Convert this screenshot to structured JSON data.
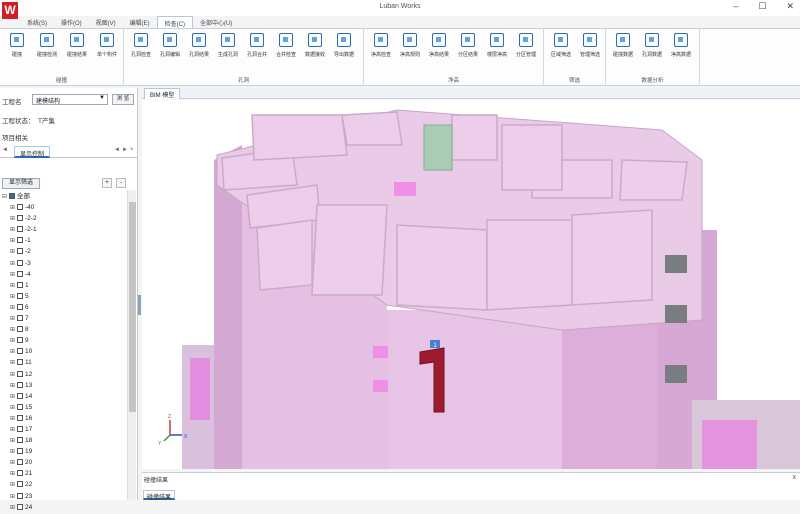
{
  "window": {
    "title": "Luban Works",
    "logo_letter": "W",
    "min": "–",
    "max": "☐",
    "close": "✕"
  },
  "menu": [
    {
      "label": "系统(S)"
    },
    {
      "label": "操作(O)"
    },
    {
      "label": "视图(V)"
    },
    {
      "label": "编辑(E)"
    },
    {
      "label": "检查(C)"
    },
    {
      "label": "全部中心(U)"
    }
  ],
  "ribbon": {
    "groups": [
      {
        "label": "碰撞",
        "buttons": [
          "碰撞",
          "碰撞检测",
          "碰撞结果",
          "单个构件"
        ]
      },
      {
        "label": "孔洞",
        "buttons": [
          "孔洞检查",
          "孔洞编辑",
          "孔洞结果",
          "生成孔洞",
          "孔洞合并",
          "合并检查",
          "数据接收",
          "导出数据"
        ]
      },
      {
        "label": "净高",
        "buttons": [
          "净高检查",
          "净高规则",
          "净高结果",
          "分区结果",
          "楼层净高",
          "分区管理"
        ]
      },
      {
        "label": "筛选",
        "buttons": [
          "区域筛选",
          "管理筛选"
        ]
      },
      {
        "label": "数据分析",
        "buttons": [
          "碰撞数据",
          "孔洞数据",
          "净高数据"
        ]
      }
    ]
  },
  "left": {
    "project_label": "工程名",
    "project_value": "建模结构",
    "browse_label": "浏 览",
    "work_status_label": "工程状态：",
    "work_status_value": "T产集",
    "project_related": "项目相关",
    "tab_label": "显示控制",
    "show_btn": "显示筛选",
    "plus": "+",
    "minus": "-",
    "nav_left": "◄",
    "nav_right": "►",
    "nav_close": "×",
    "tree_root": "全部",
    "tree_items": [
      "-40",
      "-2-2",
      "-2-1",
      "-1",
      "-2",
      "-3",
      "-4",
      "1",
      "5",
      "6",
      "7",
      "8",
      "9",
      "10",
      "11",
      "12",
      "13",
      "14",
      "15",
      "16",
      "17",
      "18",
      "19",
      "20",
      "21",
      "22",
      "23",
      "24"
    ]
  },
  "view": {
    "tab": "BIM 模型",
    "axis_x": "X",
    "axis_y": "Y",
    "axis_z": "Z",
    "marker": "1"
  },
  "bottom": {
    "title": "碰撞结果",
    "tab": "碰撞结果",
    "close": "x"
  },
  "colors": {
    "accent": "#2b6cb0",
    "brand": "#d21e23",
    "floor": "#e7c6e6",
    "wall": "#d9b3d6",
    "marker": "#9d1b2c"
  }
}
